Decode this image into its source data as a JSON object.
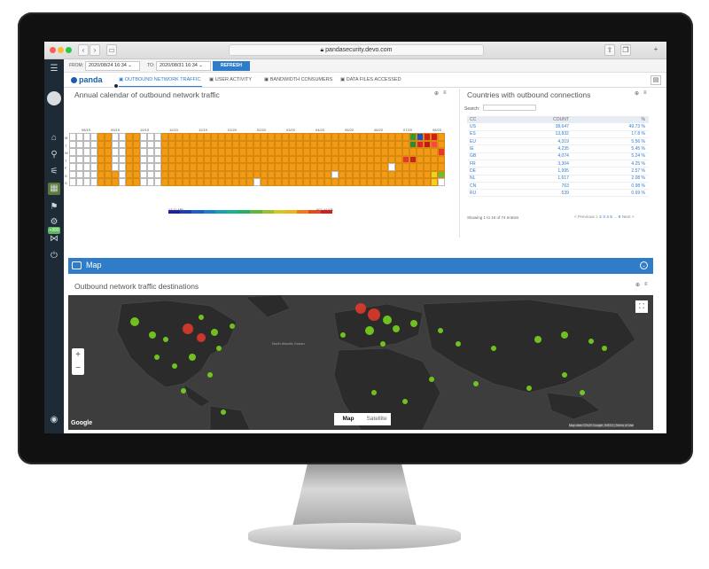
{
  "browser": {
    "url": "pandasecurity.devo.com"
  },
  "filters": {
    "from_label": "FROM:",
    "from_value": "2020/08/24 16:34",
    "to_label": "TO:",
    "to_value": "2020/08/31 16:34",
    "refresh_label": "REFRESH"
  },
  "brand": {
    "name": "panda"
  },
  "tabs": [
    {
      "label": "OUTBOUND NETWORK TRAFFIC",
      "active": true
    },
    {
      "label": "USER ACTIVITY"
    },
    {
      "label": "BANDWIDTH CONSUMERS"
    },
    {
      "label": "DATA FILES ACCESSED"
    }
  ],
  "sidebar": {
    "badge": "+999"
  },
  "calendar": {
    "title": "Annual calendar of outbound network traffic",
    "months": [
      "08/19",
      "09/19",
      "10/19",
      "11/19",
      "12/19",
      "01/20",
      "02/20",
      "03/20",
      "04/20",
      "05/20",
      "06/20",
      "07/20",
      "08/20"
    ],
    "weekdays": [
      "M",
      "T",
      "W",
      "T",
      "F",
      "S",
      "S"
    ],
    "legend_min": "13.11 MB",
    "legend_max": "607.44 KB"
  },
  "countries": {
    "title": "Countries with outbound connections",
    "search_label": "Search:",
    "headers": [
      "CC",
      "COUNT",
      "%"
    ],
    "rows": [
      [
        "US",
        "38,647",
        "49.73 %"
      ],
      [
        "ES",
        "13,832",
        "17.8 %"
      ],
      [
        "EU",
        "4,319",
        "5.56 %"
      ],
      [
        "IE",
        "4,235",
        "5.45 %"
      ],
      [
        "GB",
        "4,074",
        "5.24 %"
      ],
      [
        "FR",
        "3,304",
        "4.25 %"
      ],
      [
        "DE",
        "1,995",
        "2.57 %"
      ],
      [
        "NL",
        "1,617",
        "2.08 %"
      ],
      [
        "CN",
        "763",
        "0.98 %"
      ],
      [
        "RU",
        "539",
        "0.69 %"
      ]
    ],
    "showing": "Showing 1 to 10 of 74 entries",
    "prev": "< Previous",
    "pages": [
      "1",
      "2",
      "3",
      "4",
      "5",
      "...",
      "8"
    ],
    "next": "Next >"
  },
  "map_section": {
    "header": "Map",
    "title": "Outbound network traffic destinations",
    "map_btn": "Map",
    "satellite_btn": "Satellite",
    "google": "Google",
    "attribution": "Map data ©2020 Google, INEGI | Terms of Use",
    "ocean_label": "North Atlantic Ocean"
  },
  "colors": {
    "accent": "#2f7cc9",
    "calendar_fill": "#f39a16",
    "sidebar": "#1e2a35"
  }
}
